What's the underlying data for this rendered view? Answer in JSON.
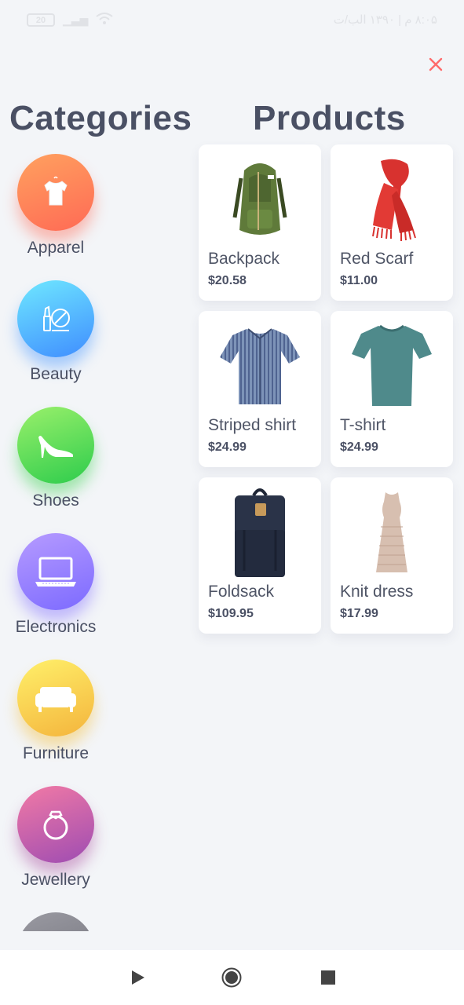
{
  "status_bar": {
    "battery": "20",
    "time_text": "۸:۰۵ م | ۱۳۹۰ الب/ت"
  },
  "close_icon": "close-icon",
  "headings": {
    "categories": "Categories",
    "products": "Products"
  },
  "categories": [
    {
      "label": "Apparel",
      "icon": "shirt-icon"
    },
    {
      "label": "Beauty",
      "icon": "makeup-icon"
    },
    {
      "label": "Shoes",
      "icon": "high-heel-icon"
    },
    {
      "label": "Electronics",
      "icon": "laptop-icon"
    },
    {
      "label": "Furniture",
      "icon": "sofa-icon"
    },
    {
      "label": "Jewellery",
      "icon": "ring-icon"
    }
  ],
  "products": [
    {
      "name": "Backpack",
      "price": "$20.58",
      "image": "backpack-image"
    },
    {
      "name": "Red Scarf",
      "price": "$11.00",
      "image": "scarf-image"
    },
    {
      "name": "Striped shirt",
      "price": "$24.99",
      "image": "striped-shirt-image"
    },
    {
      "name": "T-shirt",
      "price": "$24.99",
      "image": "tshirt-image"
    },
    {
      "name": "Foldsack",
      "price": "$109.95",
      "image": "foldsack-image"
    },
    {
      "name": "Knit dress",
      "price": "$17.99",
      "image": "knit-dress-image"
    }
  ],
  "nav_bar": {
    "back": "play-icon",
    "home": "circle-home-icon",
    "recents": "square-icon"
  },
  "colors": {
    "background": "#f3f5f8",
    "text": "#4a5064",
    "close": "#ff6b6b"
  }
}
